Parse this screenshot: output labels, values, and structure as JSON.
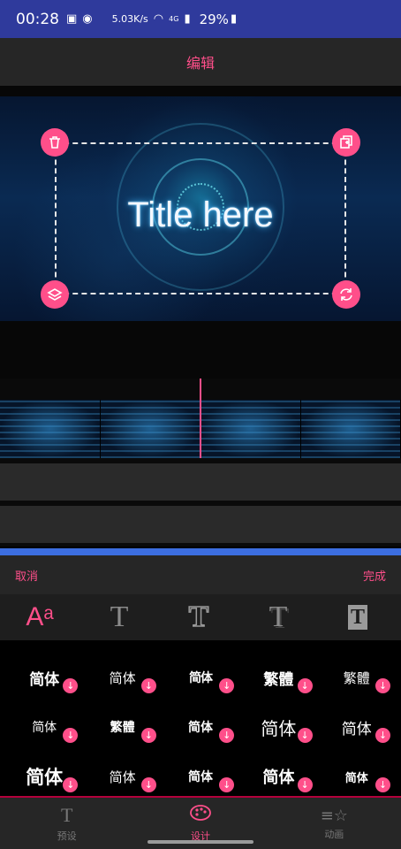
{
  "status_bar": {
    "time": "00:28",
    "network_speed": "5.03K/s",
    "signal": "4G",
    "battery": "29%",
    "icons": [
      "image-icon",
      "sync-icon",
      "wifi-icon",
      "signal-icon",
      "battery-icon"
    ]
  },
  "header": {
    "title": "编辑"
  },
  "preview": {
    "title_text": "Title here"
  },
  "text_panel": {
    "cancel_label": "取消",
    "done_label": "完成",
    "style_tabs": [
      {
        "glyph": "Aᵃ",
        "name": "font-style"
      },
      {
        "glyph": "T",
        "name": "text-color"
      },
      {
        "glyph": "T",
        "name": "text-stroke"
      },
      {
        "glyph": "T",
        "name": "text-shadow"
      },
      {
        "glyph": "T",
        "name": "text-background"
      }
    ],
    "fonts": [
      "简体",
      "简体",
      "简体",
      "繁體",
      "繁體",
      "简体",
      "繁體",
      "简体",
      "简体",
      "简体",
      "简体",
      "简体",
      "简体",
      "简体",
      "简体"
    ]
  },
  "bottom_nav": {
    "items": [
      {
        "label": "预设",
        "icon": "text-icon"
      },
      {
        "label": "设计",
        "icon": "palette-icon"
      },
      {
        "label": "动画",
        "icon": "animation-icon"
      }
    ]
  },
  "colors": {
    "accent": "#ff4f8a",
    "status_bar": "#2f3a9c",
    "divider": "#3c6ee0"
  }
}
